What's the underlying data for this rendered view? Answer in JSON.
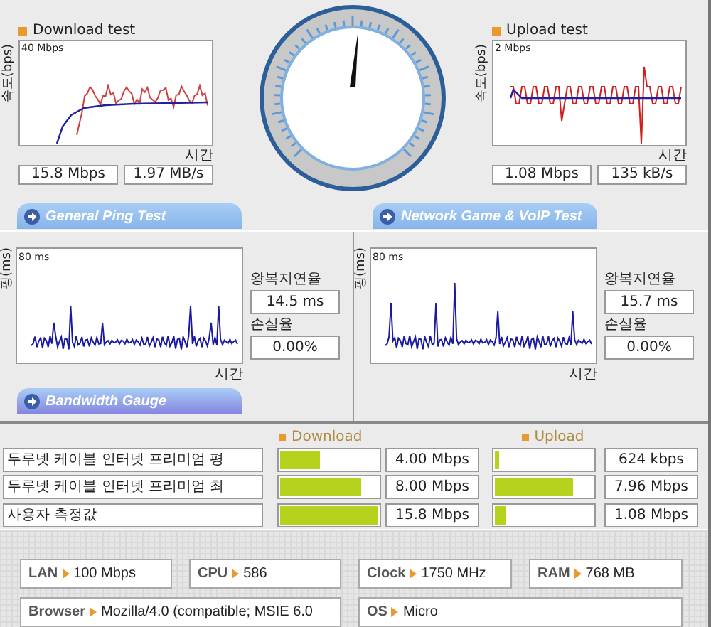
{
  "download_test": {
    "title": "Download test",
    "y_axis_label": "속도(bps)",
    "scale_label": "40 Mbps",
    "x_axis_label": "시간",
    "speed": "15.8 Mbps",
    "rate": "1.97 MB/s"
  },
  "upload_test": {
    "title": "Upload test",
    "y_axis_label": "속도(bps)",
    "scale_label": "2 Mbps",
    "x_axis_label": "시간",
    "speed": "1.08 Mbps",
    "rate": "135 kB/s"
  },
  "section_buttons": [
    {
      "label": "General Ping Test"
    },
    {
      "label": "Network Game & VoIP Test"
    }
  ],
  "ping_tests": [
    {
      "y_axis_label": "핑(ms)",
      "scale_label": "80 ms",
      "x_axis_label": "시간",
      "latency_label": "왕복지연율",
      "latency": "14.5 ms",
      "loss_label": "손실율",
      "loss": "0.00%"
    },
    {
      "y_axis_label": "핑(ms)",
      "scale_label": "80 ms",
      "x_axis_label": "시간",
      "latency_label": "왕복지연율",
      "latency": "15.7 ms",
      "loss_label": "손실율",
      "loss": "0.00%"
    }
  ],
  "bandwidth_gauge": {
    "title": "Bandwidth Gauge",
    "download_heading": "Download",
    "upload_heading": "Upload",
    "rows": [
      {
        "name": "두루넷 케이블 인터넷 프리미엄 평",
        "download": {
          "level": 0.4,
          "reading": "4.00 Mbps"
        },
        "upload": {
          "level": 0.05,
          "reading": "624 kbps"
        }
      },
      {
        "name": "두루넷 케이블 인터넷 프리미엄 최",
        "download": {
          "level": 0.82,
          "reading": "8.00 Mbps"
        },
        "upload": {
          "level": 0.8,
          "reading": "7.96 Mbps"
        }
      },
      {
        "name": "사용자 측정값",
        "download": {
          "level": 1.0,
          "reading": "15.8 Mbps"
        },
        "upload": {
          "level": 0.12,
          "reading": "1.08 Mbps"
        }
      }
    ]
  },
  "system_info": [
    {
      "label": "LAN",
      "value": "100 Mbps"
    },
    {
      "label": "CPU",
      "value": "586"
    },
    {
      "label": "Clock",
      "value": "1750 MHz"
    },
    {
      "label": "RAM",
      "value": "768 MB"
    },
    {
      "label": "Browser",
      "value": "Mozilla/4.0 (compatible; MSIE 6.0"
    },
    {
      "label": "OS",
      "value": "Micro"
    }
  ]
}
